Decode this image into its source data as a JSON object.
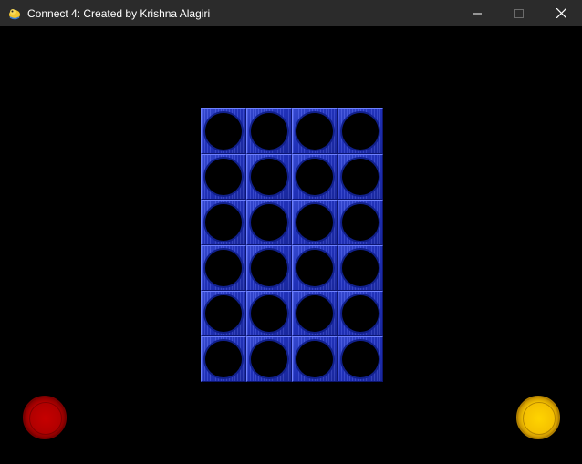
{
  "window": {
    "title": "Connect 4: Created by Krishna Alagiri",
    "icon": "pygame-snake-icon",
    "controls": [
      "minimize-icon",
      "maximize-icon",
      "close-icon"
    ]
  },
  "board": {
    "rows": 6,
    "columns": 4,
    "cells": [
      [
        "empty",
        "empty",
        "empty",
        "empty"
      ],
      [
        "empty",
        "empty",
        "empty",
        "empty"
      ],
      [
        "empty",
        "empty",
        "empty",
        "empty"
      ],
      [
        "empty",
        "empty",
        "empty",
        "empty"
      ],
      [
        "empty",
        "empty",
        "empty",
        "empty"
      ],
      [
        "empty",
        "empty",
        "empty",
        "empty"
      ]
    ],
    "color": "#2335c8"
  },
  "players": [
    {
      "chip": "red",
      "color": "#c80000"
    },
    {
      "chip": "yellow",
      "color": "#ffd200"
    }
  ]
}
